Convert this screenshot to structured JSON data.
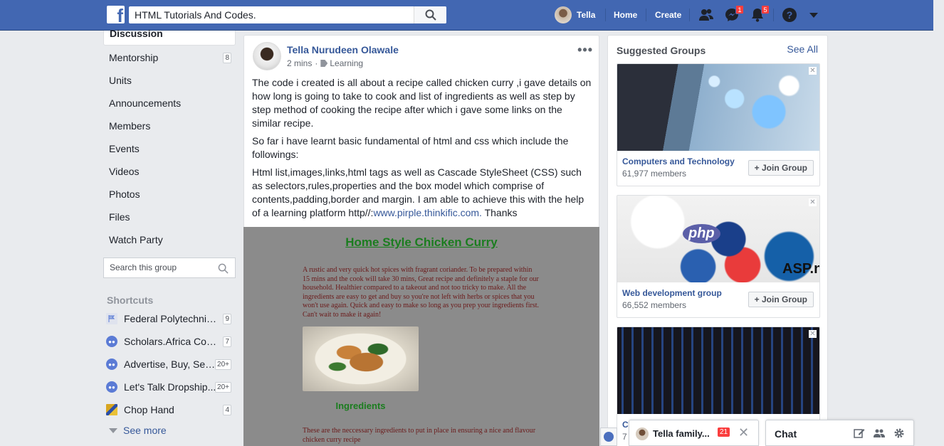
{
  "topbar": {
    "search_query": "HTML Tutorials And Codes.",
    "user_name": "Tella",
    "home": "Home",
    "create": "Create",
    "messages_count": "1",
    "notifications_count": "5",
    "brand_color": "#4267b2"
  },
  "sidebar": {
    "active": "Discussion",
    "items": [
      {
        "label": "Mentorship",
        "count": "8"
      },
      {
        "label": "Units",
        "count": ""
      },
      {
        "label": "Announcements",
        "count": ""
      },
      {
        "label": "Members",
        "count": ""
      },
      {
        "label": "Events",
        "count": ""
      },
      {
        "label": "Videos",
        "count": ""
      },
      {
        "label": "Photos",
        "count": ""
      },
      {
        "label": "Files",
        "count": ""
      },
      {
        "label": "Watch Party",
        "count": ""
      }
    ],
    "search_placeholder": "Search this group",
    "shortcuts_title": "Shortcuts",
    "shortcuts": [
      {
        "label": "Federal Polytechnic ...",
        "count": "9"
      },
      {
        "label": "Scholars.Africa Com...",
        "count": "7"
      },
      {
        "label": "Advertise, Buy, Sell...",
        "count": "20+"
      },
      {
        "label": "Let's Talk Dropship...",
        "count": "20+"
      },
      {
        "label": "Chop Hand",
        "count": "4"
      }
    ],
    "see_more": "See more"
  },
  "post": {
    "author": "Tella Nurudeen Olawale",
    "time": "2 mins",
    "separator": "·",
    "tag": "Learning",
    "more": "•••",
    "p1": "The code i created is all about a recipe called chicken curry ,i gave details on how long is going to take to cook and list of ingredients as well as step by step method of cooking the recipe after which i gave some links on the similar recipe.",
    "p2": "So far i have learnt basic fundamental of html and css which include the followings:",
    "p3_prefix": "Html list,images,links,html tags as well as Cascade StyleSheet (CSS) such as selectors,rules,properties and the box model which comprise of contents,padding,border and margin. I am able to achieve this with the help of a learning platform http//:",
    "p3_link": "www.pirple.thinkific.com.",
    "p3_suffix": " Thanks",
    "embed": {
      "title": "Home Style Chicken Curry",
      "intro": "A rustic and very quick hot spices with fragrant coriander. To be prepared within 15 mins and the cook will take 30 mins, Great recipe and definitely a staple for our household. Healthier compared to a takeout and not too tricky to make. All the ingredients are easy to get and buy so you're not left with herbs or spices that you won't use again. Quick and easy to make so long as you prep your ingredients first. Can't wait to make it again!",
      "ingredients_title": "Ingredients",
      "ingredients_text": "These are the neccessary ingredients to put in place in ensuring a nice and flavour chicken curry recipe"
    }
  },
  "suggested": {
    "title": "Suggested Groups",
    "see_all": "See All",
    "join_label": "+ Join Group",
    "groups": [
      {
        "name": "Computers and Technology",
        "members": "61,977 members"
      },
      {
        "name": "Web development group",
        "members": "66,552 members"
      },
      {
        "name": "C",
        "members": "7"
      }
    ],
    "img2_php": "php",
    "img2_asp": "ASP.ne"
  },
  "chat": {
    "tab_name": "Tella family...",
    "tab_count": "21",
    "close": "✕",
    "label": "Chat"
  }
}
